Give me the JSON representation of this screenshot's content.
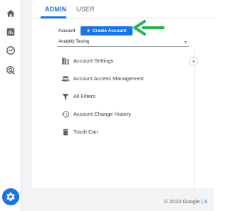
{
  "tabs": [
    {
      "label": "ADMIN",
      "active": true
    },
    {
      "label": "USER",
      "active": false
    }
  ],
  "account": {
    "label": "Account",
    "create_button_label": "Create Account",
    "selected_account": "Analytify Testing"
  },
  "menu": [
    {
      "label": "Account Settings",
      "icon": "building-icon"
    },
    {
      "label": "Account Access Management",
      "icon": "people-icon"
    },
    {
      "label": "All Filters",
      "icon": "filter-icon"
    },
    {
      "label": "Account Change History",
      "icon": "history-icon"
    },
    {
      "label": "Trash Can",
      "icon": "trash-icon"
    }
  ],
  "footer": {
    "copyright": "© 2023 Google",
    "separator": "|",
    "link": "A"
  },
  "colors": {
    "accent": "#1a73e8",
    "arrow": "#1fb847"
  }
}
